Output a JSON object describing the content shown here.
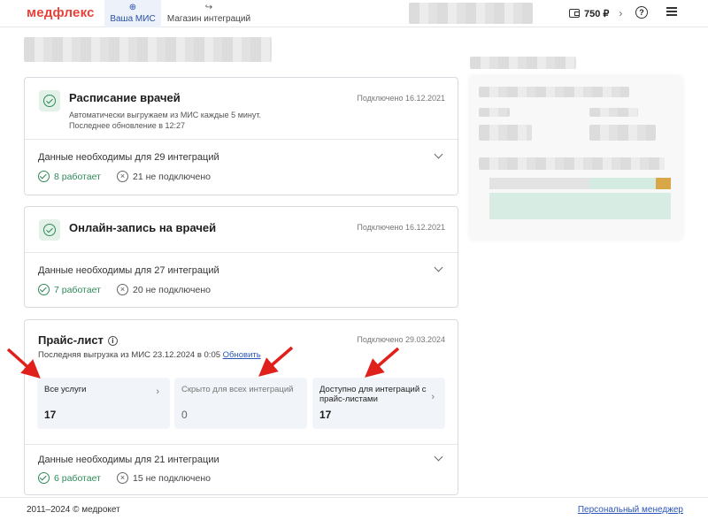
{
  "header": {
    "logo": "медфлекс",
    "tabs": [
      {
        "label": "Ваша МИС",
        "icon": "arrow-right-circle-icon",
        "active": true
      },
      {
        "label": "Магазин интеграций",
        "icon": "shop-arrow-icon",
        "active": false
      }
    ],
    "balance": "750 ₽",
    "help_symbol": "?"
  },
  "cards": [
    {
      "title": "Расписание врачей",
      "date": "Подключено 16.12.2021",
      "description_line1": "Автоматически выгружаем из МИС каждые 5 минут.",
      "description_line2": "Последнее обновление в 12:27",
      "needed": "Данные необходимы для 29 интеграций",
      "working": "8 работает",
      "not_connected": "21 не подключено"
    },
    {
      "title": "Онлайн-запись на врачей",
      "date": "Подключено 16.12.2021",
      "needed": "Данные необходимы для 27 интеграций",
      "working": "7 работает",
      "not_connected": "20 не подключено"
    }
  ],
  "price_card": {
    "title": "Прайс-лист",
    "date": "Подключено 29.03.2024",
    "last_upload": "Последняя выгрузка из МИС 23.12.2024 в 0:05",
    "refresh_link": "Обновить",
    "tiles": [
      {
        "label": "Все услуги",
        "value": "17"
      },
      {
        "label": "Скрыто для всех интеграций",
        "value": "0"
      },
      {
        "label_line1": "Доступно для интеграций с",
        "label_line2": "прайс-листами",
        "value": "17"
      }
    ],
    "needed": "Данные необходимы для 21 интеграции",
    "working": "6 работает",
    "not_connected": "15 не подключено"
  },
  "footer": {
    "copyright": "2011–2024 © медрокет",
    "manager_link": "Персональный менеджер"
  },
  "colors": {
    "brand": "#e8423a",
    "success": "#2e8b57",
    "link": "#2b55b8",
    "annotation_arrow": "#e0201b"
  }
}
